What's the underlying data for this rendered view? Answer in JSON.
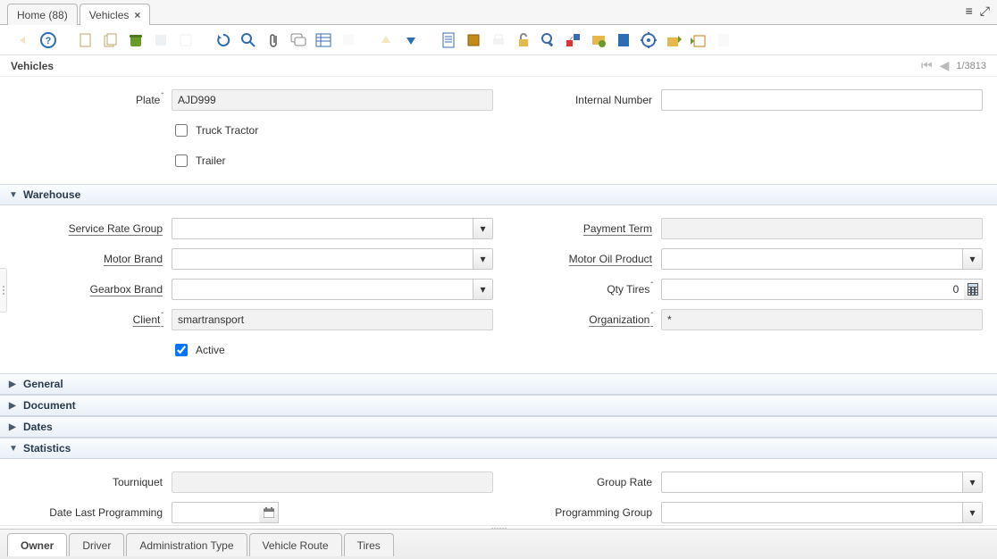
{
  "tabs": {
    "home": "Home (88)",
    "vehicles": "Vehicles"
  },
  "title": "Vehicles",
  "paging": {
    "counter": "1/3813"
  },
  "fields": {
    "plate_label": "Plate",
    "plate_value": "AJD999",
    "internal_number_label": "Internal Number",
    "internal_number_value": "",
    "truck_tractor_label": "Truck Tractor",
    "trailer_label": "Trailer",
    "service_rate_group_label": "Service Rate Group",
    "payment_term_label": "Payment Term",
    "motor_brand_label": "Motor Brand",
    "motor_oil_product_label": "Motor Oil Product",
    "gearbox_brand_label": "Gearbox Brand",
    "qty_tires_label": "Qty Tires",
    "qty_tires_value": "0",
    "client_label": "Client",
    "client_value": "smartransport",
    "organization_label": "Organization",
    "organization_value": "*",
    "active_label": "Active",
    "tourniquet_label": "Tourniquet",
    "group_rate_label": "Group Rate",
    "date_last_prog_label": "Date Last Programming",
    "programming_group_label": "Programming Group"
  },
  "sections": {
    "warehouse": "Warehouse",
    "general": "General",
    "document": "Document",
    "dates": "Dates",
    "statistics": "Statistics"
  },
  "bottom_tabs": {
    "owner": "Owner",
    "driver": "Driver",
    "admin_type": "Administration Type",
    "vehicle_route": "Vehicle Route",
    "tires": "Tires"
  }
}
